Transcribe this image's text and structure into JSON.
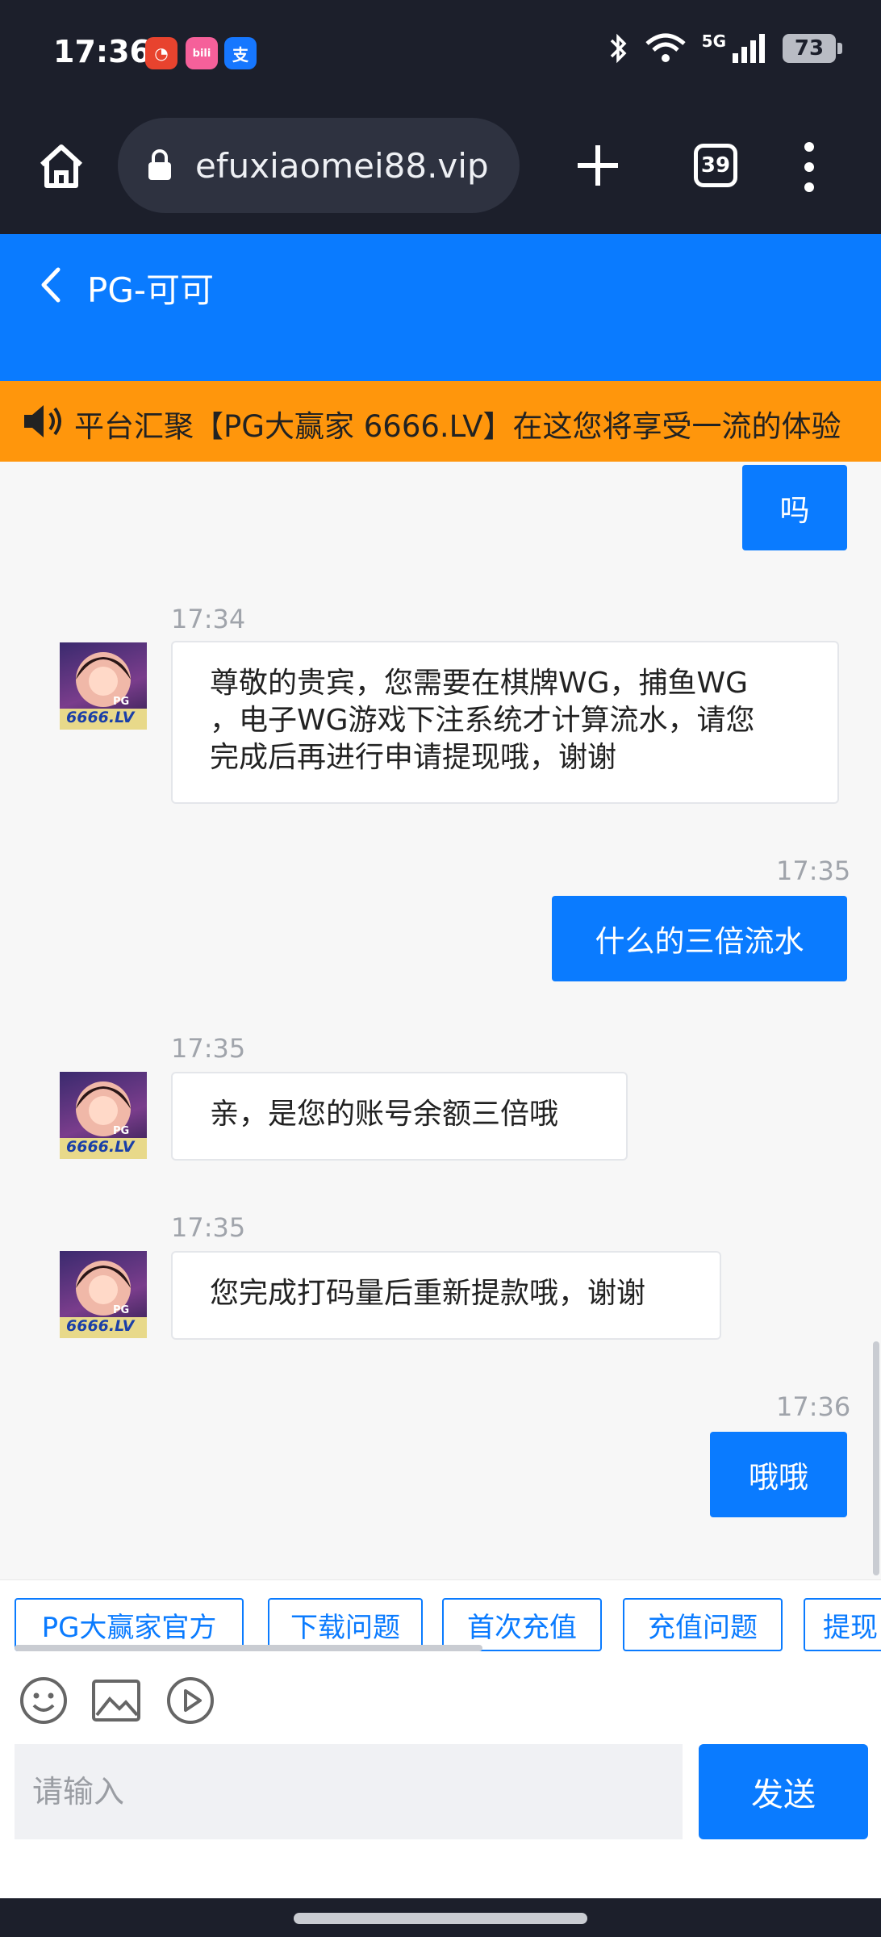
{
  "status": {
    "time": "17:36",
    "battery": "73",
    "apps": [
      "red-app-icon",
      "bilibili-icon",
      "alipay-icon"
    ],
    "signal_label": "5G"
  },
  "browser": {
    "url": "efuxiaomei88.vip",
    "tab_count": "39"
  },
  "chat": {
    "title": "PG-可可",
    "announcement": "平台汇聚【PG大赢家 6666.LV】在这您将享受一流的体验",
    "avatar_label": "6666.LV",
    "avatar_badge": "PG",
    "messages": [
      {
        "side": "right",
        "time": "",
        "text": "吗"
      },
      {
        "side": "left",
        "time": "17:34",
        "lines": [
          "尊敬的贵宾，您需要在棋牌WG，捕鱼WG",
          "，电子WG游戏下注系统才计算流水，请您",
          "完成后再进行申请提现哦，谢谢"
        ]
      },
      {
        "side": "right",
        "time": "17:35",
        "text": "什么的三倍流水"
      },
      {
        "side": "left",
        "time": "17:35",
        "text": "亲，是您的账号余额三倍哦"
      },
      {
        "side": "left",
        "time": "17:35",
        "text": "您完成打码量后重新提款哦，谢谢"
      },
      {
        "side": "right",
        "time": "17:36",
        "text": "哦哦"
      }
    ]
  },
  "quick_replies": [
    "PG大赢家官方",
    "下载问题",
    "首次充值",
    "充值问题",
    "提现"
  ],
  "tools": [
    "emoji-icon",
    "image-icon",
    "video-icon"
  ],
  "input": {
    "placeholder": "请输入",
    "send_label": "发送"
  },
  "colors": {
    "accent": "#0a7bff",
    "banner": "#ff960c",
    "dark": "#1c1f2b"
  }
}
